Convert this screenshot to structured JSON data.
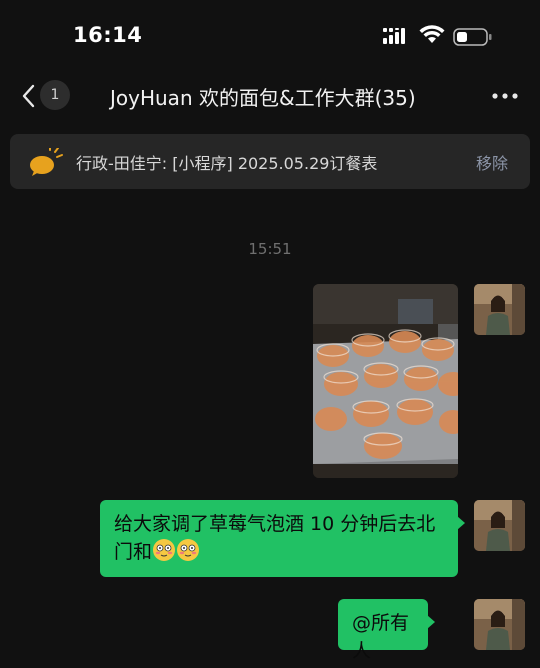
{
  "status_bar": {
    "time": "16:14"
  },
  "nav": {
    "unread_count": "1",
    "title": "JoyHuan 欢的面包&工作大群(35)"
  },
  "pinned": {
    "text": "行政-田佳宁: [小程序] 2025.05.29订餐表",
    "remove_label": "移除"
  },
  "chat": {
    "timestamp": "15:51",
    "messages": [
      {
        "type": "image",
        "description": ""
      },
      {
        "type": "text",
        "text": "给大家调了草莓气泡酒 10 分钟后去北门和"
      },
      {
        "type": "text",
        "text": "@所有人"
      }
    ]
  },
  "colors": {
    "accent_bubble": "#21c164",
    "background": "#111111",
    "pin_bg": "#262626"
  }
}
